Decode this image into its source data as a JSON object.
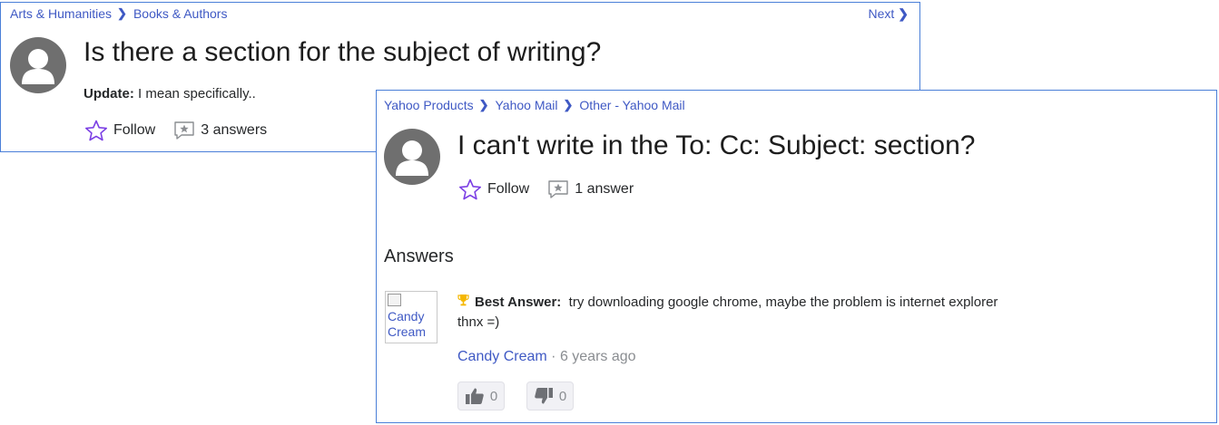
{
  "card1": {
    "breadcrumb": [
      "Arts & Humanities",
      "Books & Authors"
    ],
    "next_label": "Next",
    "title": "Is there a section for the subject of writing?",
    "update_label": "Update:",
    "update_text": "I mean specifically..",
    "follow_label": "Follow",
    "answers_count": "3 answers"
  },
  "card2": {
    "breadcrumb": [
      "Yahoo Products",
      "Yahoo Mail",
      "Other - Yahoo Mail"
    ],
    "title": "I can't write in the To: Cc: Subject: section?",
    "follow_label": "Follow",
    "answers_count": "1 answer",
    "answers_heading": "Answers",
    "best_answer": {
      "image_alt": "Candy Cream",
      "label": "Best Answer:",
      "text": "try downloading google chrome, maybe the problem is internet explorer",
      "text_line2": "thnx =)",
      "author": "Candy Cream",
      "separator": "·",
      "time_ago": "6 years ago",
      "thumbs_up": "0",
      "thumbs_down": "0"
    }
  },
  "icons": [
    "chevron-right-icon",
    "avatar-icon",
    "star-outline-icon",
    "answer-bubble-icon",
    "trophy-icon",
    "thumbs-up-icon",
    "thumbs-down-icon"
  ],
  "colors": {
    "link": "#3f59c4",
    "border": "#4a7fd8",
    "follow_star": "#7b3fe4",
    "muted": "#8a8d91"
  }
}
